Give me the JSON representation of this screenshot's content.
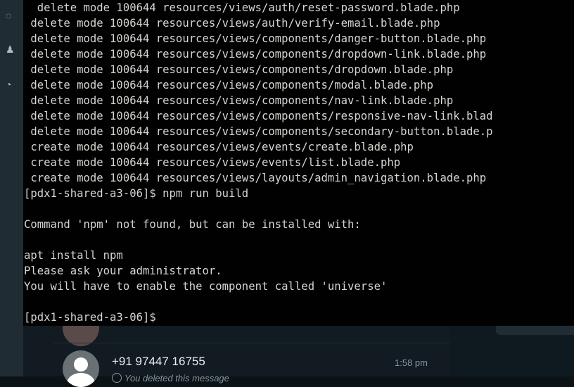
{
  "terminal": {
    "lines": [
      "  delete mode 100644 resources/views/auth/reset-password.blade.php",
      " delete mode 100644 resources/views/auth/verify-email.blade.php",
      " delete mode 100644 resources/views/components/danger-button.blade.php",
      " delete mode 100644 resources/views/components/dropdown-link.blade.php",
      " delete mode 100644 resources/views/components/dropdown.blade.php",
      " delete mode 100644 resources/views/components/modal.blade.php",
      " delete mode 100644 resources/views/components/nav-link.blade.php",
      " delete mode 100644 resources/views/components/responsive-nav-link.blad",
      " delete mode 100644 resources/views/components/secondary-button.blade.p",
      " create mode 100644 resources/views/events/create.blade.php",
      " create mode 100644 resources/views/events/list.blade.php",
      " create mode 100644 resources/views/layouts/admin_navigation.blade.php",
      "[pdx1-shared-a3-06]$ npm run build",
      "",
      "Command 'npm' not found, but can be installed with:",
      "",
      "apt install npm",
      "Please ask your administrator.",
      "You will have to enable the component called 'universe'",
      "",
      "[pdx1-shared-a3-06]$"
    ]
  },
  "chats": [
    {
      "name": "",
      "time": "",
      "preview": "",
      "avatar": "photo"
    },
    {
      "name": "+91 97447 16755",
      "time": "1:58 pm",
      "preview": "You deleted this message",
      "avatar": "default-user-icon"
    }
  ],
  "colors": {
    "terminal_bg": "#010101",
    "terminal_fg": "#d3d7cf",
    "app_bg": "#111b21",
    "secondary_text": "#8696a0"
  }
}
